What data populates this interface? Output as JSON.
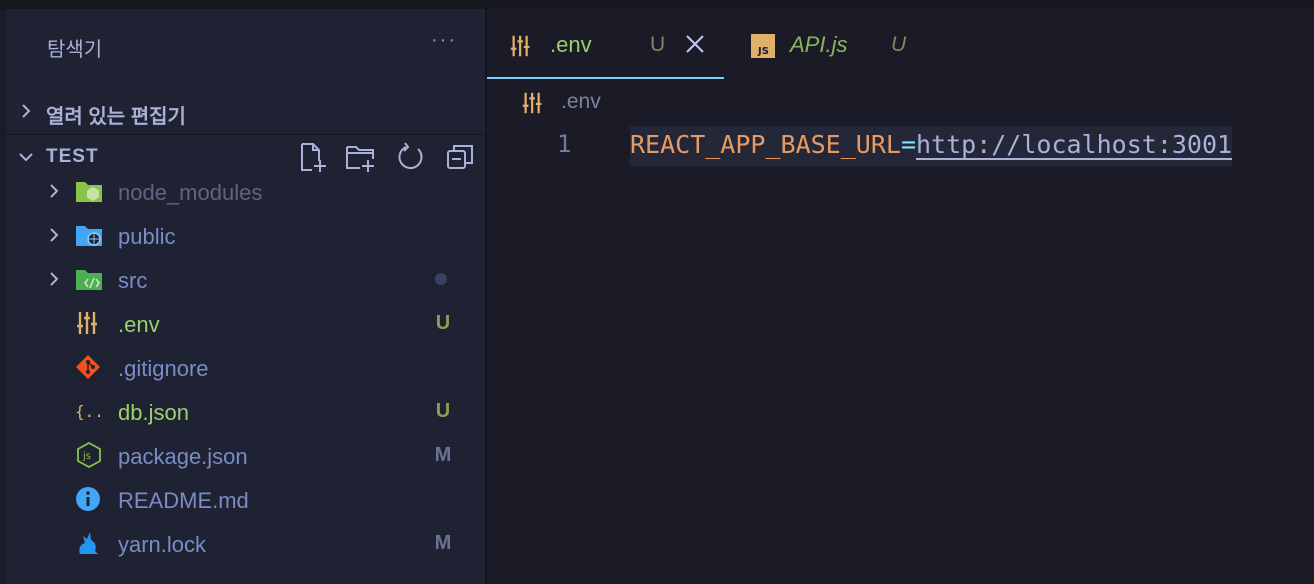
{
  "sidebar": {
    "title": "탐색기",
    "more_label": "···",
    "open_editors_label": "열려 있는 편집기",
    "workspace_label": "TEST",
    "tree": [
      {
        "name": "node_modules",
        "type": "folder",
        "icon": "node-folder-icon",
        "color": "#5e6482",
        "badge": "",
        "dot": false
      },
      {
        "name": "public",
        "type": "folder",
        "icon": "public-folder-icon",
        "color": "#7a8cc7",
        "badge": "",
        "dot": false
      },
      {
        "name": "src",
        "type": "folder",
        "icon": "src-folder-icon",
        "color": "#7a8cc7",
        "badge": "",
        "dot": true
      },
      {
        "name": ".env",
        "type": "file",
        "icon": "env-settings-icon",
        "color": "#9ece6a",
        "badge": "U",
        "badge_color": "#8e9c5a"
      },
      {
        "name": ".gitignore",
        "type": "file",
        "icon": "git-icon",
        "color": "#7a8cc7",
        "badge": ""
      },
      {
        "name": "db.json",
        "type": "file",
        "icon": "json-braces-icon",
        "color": "#9ece6a",
        "badge": "U",
        "badge_color": "#8e9c5a"
      },
      {
        "name": "package.json",
        "type": "file",
        "icon": "nodejs-icon",
        "color": "#7a8cc7",
        "badge": "M",
        "badge_color": "#6b7394"
      },
      {
        "name": "README.md",
        "type": "file",
        "icon": "info-icon",
        "color": "#7a8cc7",
        "badge": ""
      },
      {
        "name": "yarn.lock",
        "type": "file",
        "icon": "yarn-cat-icon",
        "color": "#7a8cc7",
        "badge": "M",
        "badge_color": "#6b7394"
      }
    ]
  },
  "tabs": [
    {
      "name": ".env",
      "badge": "U",
      "active": true,
      "close_label": "×"
    },
    {
      "name": "API.js",
      "badge": "U",
      "active": false,
      "icon_text": "JS"
    }
  ],
  "breadcrumb": {
    "file": ".env"
  },
  "editor": {
    "line_number": "1",
    "key": "REACT_APP_BASE_URL",
    "equals": "=",
    "value": "http://localhost:3001"
  },
  "colors": {
    "accent": "#7dcfff",
    "key": "#e79a62",
    "sidebar_bg": "#1f2233",
    "editor_bg": "#1a1b26"
  }
}
